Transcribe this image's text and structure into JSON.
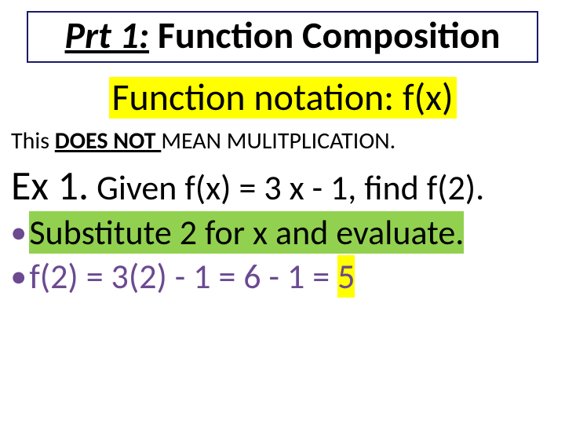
{
  "title": {
    "prefix": "Prt 1:",
    "rest": " Function Composition"
  },
  "subtitle": "Function notation: f(x)",
  "note": {
    "pre": "This ",
    "emph": "DOES NOT ",
    "post": "MEAN MULITPLICATION."
  },
  "example": {
    "label": "Ex 1.",
    "text": " Given f(x) = 3 x - 1, find f(2)."
  },
  "bullets": {
    "b1": "Substitute 2 for x and evaluate.",
    "b2_pre": "f(2) = 3(2) - 1 = 6 - 1 = ",
    "b2_ans": "5"
  }
}
